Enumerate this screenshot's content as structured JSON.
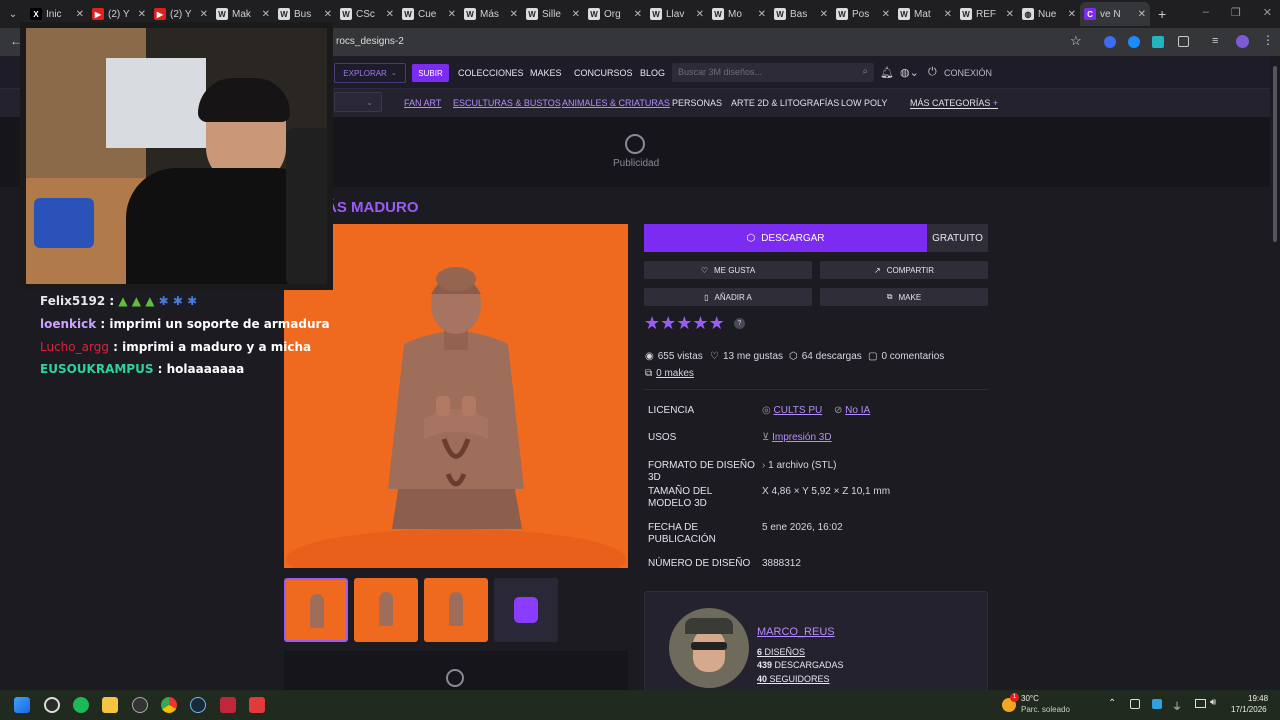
{
  "browser": {
    "tabs": [
      {
        "label": "Inic",
        "fav": "X",
        "type": "x"
      },
      {
        "label": "(2) Y",
        "fav": "▶",
        "type": "yt"
      },
      {
        "label": "(2) Y",
        "fav": "▶",
        "type": "yt"
      },
      {
        "label": "Mak",
        "fav": "W",
        "type": "w"
      },
      {
        "label": "Bus",
        "fav": "W",
        "type": "w"
      },
      {
        "label": "CSc",
        "fav": "W",
        "type": "w"
      },
      {
        "label": "Cue",
        "fav": "W",
        "type": "w"
      },
      {
        "label": "Más",
        "fav": "W",
        "type": "w"
      },
      {
        "label": "Sille",
        "fav": "W",
        "type": "w"
      },
      {
        "label": "Org",
        "fav": "W",
        "type": "w"
      },
      {
        "label": "Llav",
        "fav": "W",
        "type": "w"
      },
      {
        "label": "Mo",
        "fav": "W",
        "type": "w"
      },
      {
        "label": "Bas",
        "fav": "W",
        "type": "w"
      },
      {
        "label": "Pos",
        "fav": "W",
        "type": "w"
      },
      {
        "label": "Mat",
        "fav": "W",
        "type": "w"
      },
      {
        "label": "REF",
        "fav": "W",
        "type": "w"
      },
      {
        "label": "Nue",
        "fav": "◍",
        "type": "w"
      },
      {
        "label": "ve N",
        "fav": "C",
        "type": "active"
      }
    ],
    "new_tab": "+",
    "url": "rocs_designs-2"
  },
  "site": {
    "nav": {
      "explore": "EXPLORAR",
      "upload": "SUBIR",
      "collections": "COLECCIONES",
      "makes": "MAKES",
      "contests": "CONCURSOS",
      "blog": "BLOG",
      "search_placeholder": "Buscar 3M diseños...",
      "login": "CONEXIÓN"
    },
    "categories": [
      "FAN ART",
      "ESCULTURAS & BUSTOS",
      "ANIMALES & CRIATURAS",
      "PERSONAS",
      "ARTE 2D & LITOGRAFÍAS",
      "LOW POLY"
    ],
    "more_categories": "MÁS CATEGORÍAS",
    "ad_label": "Publicidad",
    "title": "ÁS MADURO"
  },
  "actions": {
    "download": "DESCARGAR",
    "price": "GRATUITO",
    "like": "ME GUSTA",
    "share": "COMPARTIR",
    "add": "AÑADIR A",
    "make": "MAKE"
  },
  "rating": {
    "stars": 5,
    "help": "?"
  },
  "stats": {
    "views": "655 vistas",
    "likes": "13 me gustas",
    "downloads": "64 descargas",
    "comments": "0 comentarios",
    "makes": "0 makes"
  },
  "details": [
    {
      "label": "LICENCIA",
      "values": [
        "CULTS PU",
        "No IA"
      ]
    },
    {
      "label": "USOS",
      "values": [
        "Impresión 3D"
      ]
    },
    {
      "label": "FORMATO DE DISEÑO 3D",
      "values": [
        "1 archivo (STL)"
      ]
    },
    {
      "label": "TAMAÑO DEL MODELO 3D",
      "values": [
        "X 4,86 × Y 5,92 × Z 10,1 mm"
      ]
    },
    {
      "label": "FECHA DE PUBLICACIÓN",
      "values": [
        "5 ene 2026, 16:02"
      ]
    },
    {
      "label": "NÚMERO DE DISEÑO",
      "values": [
        "3888312"
      ]
    }
  ],
  "author": {
    "name": "MARCO_REUS",
    "designs_num": "6",
    "designs": "DISEÑOS",
    "downloads_num": "439",
    "downloads": "DESCARGADAS",
    "followers_num": "40",
    "followers": "SEGUIDORES"
  },
  "chat": [
    {
      "user": "Felix5192",
      "text": "",
      "color": "#e8e8e8",
      "emotes": 6
    },
    {
      "user": "loenkick",
      "text": "imprimi un soporte de armadura",
      "color": "#c9a3ff"
    },
    {
      "user": "Lucho_argg",
      "text": "imprimi a maduro y a micha",
      "color": "#e0203c"
    },
    {
      "user": "EUSOUKRAMPUS",
      "text": "holaaaaaaa",
      "color": "#2fd39a"
    }
  ],
  "taskbar": {
    "temp": "30°C",
    "weather": "Parc. soleado",
    "time": "19:48",
    "date": "17/1/2026",
    "weather_badge": "1"
  },
  "colors": {
    "accent": "#7c2bf0",
    "link": "#b78cff",
    "star": "#9a5cf5",
    "product_bg": "#ef6a1e"
  }
}
